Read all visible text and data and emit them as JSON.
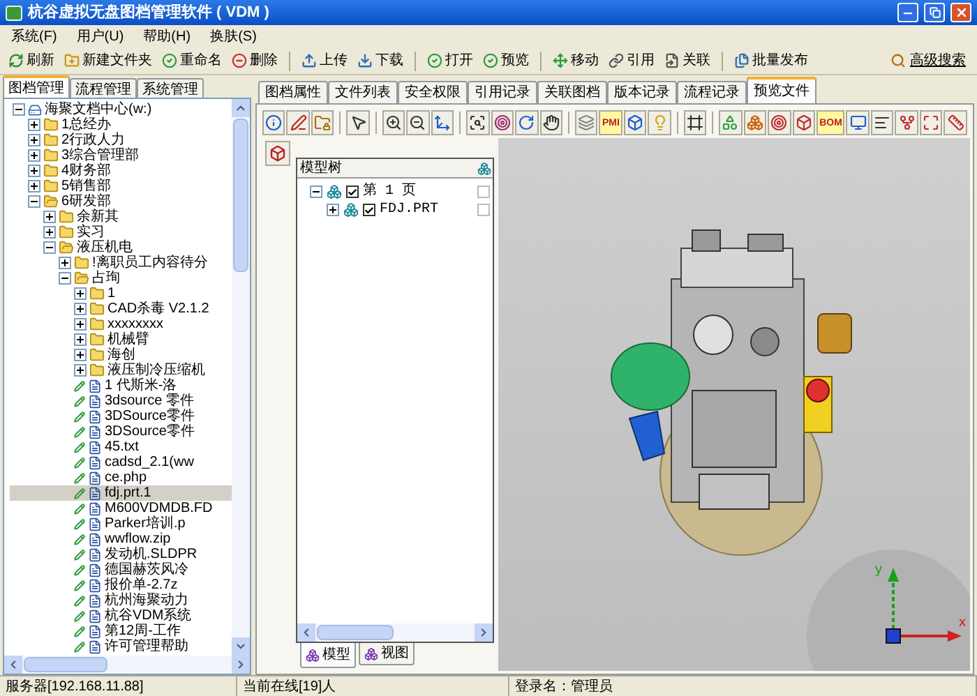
{
  "window": {
    "title": "杭谷虚拟无盘图档管理软件 ( VDM )"
  },
  "menu": [
    "系统(F)",
    "用户(U)",
    "帮助(H)",
    "换肤(S)"
  ],
  "toolbar": [
    {
      "kind": "button",
      "label": "刷新"
    },
    {
      "kind": "button",
      "label": "新建文件夹"
    },
    {
      "kind": "button",
      "label": "重命名"
    },
    {
      "kind": "button",
      "label": "删除"
    },
    {
      "kind": "separator"
    },
    {
      "kind": "button",
      "label": "上传"
    },
    {
      "kind": "button",
      "label": "下载"
    },
    {
      "kind": "separator"
    },
    {
      "kind": "button",
      "label": "打开"
    },
    {
      "kind": "button",
      "label": "预览"
    },
    {
      "kind": "separator"
    },
    {
      "kind": "button",
      "label": "移动"
    },
    {
      "kind": "button",
      "label": "引用"
    },
    {
      "kind": "button",
      "label": "关联"
    },
    {
      "kind": "separator"
    },
    {
      "kind": "button",
      "label": "批量发布"
    }
  ],
  "advanced_search": "高级搜索",
  "left_tabs": [
    {
      "label": "图档管理",
      "selected": true
    },
    {
      "label": "流程管理",
      "selected": false
    },
    {
      "label": "系统管理",
      "selected": false
    }
  ],
  "tree": {
    "kind": "drive",
    "label": "海聚文档中心(w:)",
    "expanded": true,
    "selected": false,
    "children": [
      {
        "kind": "folder",
        "label": "1总经办",
        "expanded": false,
        "selected": false
      },
      {
        "kind": "folder",
        "label": "2行政人力",
        "expanded": false,
        "selected": false
      },
      {
        "kind": "folder",
        "label": "3综合管理部",
        "expanded": false,
        "selected": false
      },
      {
        "kind": "folder",
        "label": "4财务部",
        "expanded": false,
        "selected": false
      },
      {
        "kind": "folder",
        "label": "5销售部",
        "expanded": false,
        "selected": false
      },
      {
        "kind": "folder",
        "label": "6研发部",
        "expanded": true,
        "selected": false,
        "children": [
          {
            "kind": "folder",
            "label": "余新其",
            "expanded": false,
            "selected": false
          },
          {
            "kind": "folder",
            "label": "实习",
            "expanded": false,
            "selected": false
          },
          {
            "kind": "folder",
            "label": "液压机电",
            "expanded": true,
            "selected": false,
            "children": [
              {
                "kind": "folder",
                "label": "!离职员工内容待分",
                "expanded": false,
                "selected": false
              },
              {
                "kind": "folder",
                "label": "占珣",
                "expanded": true,
                "selected": false,
                "children": [
                  {
                    "kind": "folder",
                    "label": "1",
                    "expanded": false,
                    "selected": false
                  },
                  {
                    "kind": "folder",
                    "label": "CAD杀毒 V2.1.2",
                    "expanded": false,
                    "selected": false
                  },
                  {
                    "kind": "folder",
                    "label": "xxxxxxxx",
                    "expanded": false,
                    "selected": false
                  },
                  {
                    "kind": "folder",
                    "label": "机械臂",
                    "expanded": false,
                    "selected": false
                  },
                  {
                    "kind": "folder",
                    "label": "海创",
                    "expanded": false,
                    "selected": false
                  },
                  {
                    "kind": "folder",
                    "label": "液压制冷压缩机",
                    "expanded": false,
                    "selected": false
                  },
                  {
                    "kind": "file",
                    "label": "1 代斯米-洛",
                    "selected": false
                  },
                  {
                    "kind": "file",
                    "label": "3dsource 零件",
                    "selected": false
                  },
                  {
                    "kind": "file",
                    "label": "3DSource零件",
                    "selected": false
                  },
                  {
                    "kind": "file",
                    "label": "3DSource零件",
                    "selected": false
                  },
                  {
                    "kind": "file",
                    "label": "45.txt",
                    "selected": false
                  },
                  {
                    "kind": "file",
                    "label": "cadsd_2.1(ww",
                    "selected": false
                  },
                  {
                    "kind": "file",
                    "label": "ce.php",
                    "selected": false
                  },
                  {
                    "kind": "file",
                    "label": "fdj.prt.1",
                    "selected": true
                  },
                  {
                    "kind": "file",
                    "label": "M600VDMDB.FD",
                    "selected": false
                  },
                  {
                    "kind": "file",
                    "label": "Parker培训.p",
                    "selected": false
                  },
                  {
                    "kind": "file",
                    "label": "wwflow.zip",
                    "selected": false
                  },
                  {
                    "kind": "file",
                    "label": "发动机.SLDPR",
                    "selected": false
                  },
                  {
                    "kind": "file",
                    "label": "德国赫茨风冷",
                    "selected": false
                  },
                  {
                    "kind": "file",
                    "label": "报价单-2.7z",
                    "selected": false
                  },
                  {
                    "kind": "file",
                    "label": "杭州海聚动力",
                    "selected": false
                  },
                  {
                    "kind": "file",
                    "label": "杭谷VDM系统",
                    "selected": false
                  },
                  {
                    "kind": "file",
                    "label": "第12周-工作",
                    "selected": false
                  },
                  {
                    "kind": "file",
                    "label": "许可管理帮助",
                    "selected": false
                  }
                ]
              }
            ]
          }
        ]
      }
    ]
  },
  "detail_tabs": [
    {
      "label": "图档属性",
      "selected": false
    },
    {
      "label": "文件列表",
      "selected": false
    },
    {
      "label": "安全权限",
      "selected": false
    },
    {
      "label": "引用记录",
      "selected": false
    },
    {
      "label": "关联图档",
      "selected": false
    },
    {
      "label": "版本记录",
      "selected": false
    },
    {
      "label": "流程记录",
      "selected": false
    },
    {
      "label": "预览文件",
      "selected": true
    }
  ],
  "viewer_toolbar": {
    "labels": [
      "PMI",
      "BOM"
    ]
  },
  "model_tree": {
    "header": "模型树",
    "nodes": [
      {
        "label": "第 1 页",
        "expanded": true,
        "checked": true,
        "marked": false,
        "children": [
          {
            "label": "FDJ.PRT",
            "expanded": false,
            "checked": true,
            "marked": false
          }
        ]
      }
    ]
  },
  "model_tabs": [
    {
      "label": "模型",
      "selected": true
    },
    {
      "label": "视图",
      "selected": false
    }
  ],
  "axis_labels": [
    "y",
    "x"
  ],
  "status_bar": [
    "服务器[192.168.11.88]",
    "当前在线[19]人",
    "登录名：管理员"
  ]
}
